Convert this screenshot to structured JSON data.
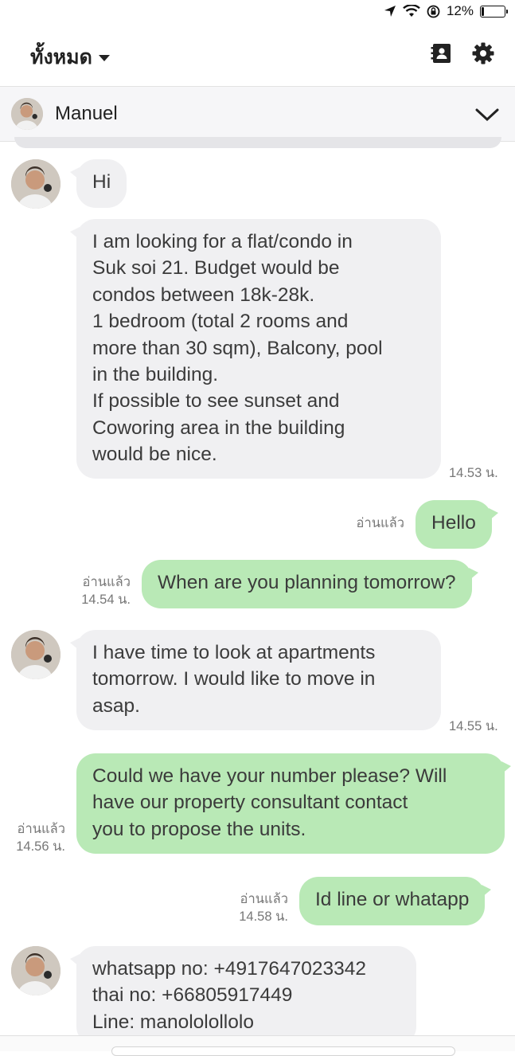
{
  "status_bar": {
    "battery": "12%",
    "battery_level": 0.12
  },
  "header": {
    "filter_label": "ทั้งหมด"
  },
  "contact": {
    "name": "Manuel"
  },
  "messages": {
    "m1": {
      "text": "Hi"
    },
    "m2": {
      "text": "I am looking for a flat/condo in\nSuk soi 21. Budget would be\ncondos between 18k-28k.\n1 bedroom (total 2 rooms and\nmore than 30 sqm), Balcony, pool\nin the building.\nIf possible to see sunset and\nCoworing area in the building\nwould be nice.",
      "time": "14.53 น."
    },
    "m3": {
      "text": "Hello",
      "read": "อ่านแล้ว"
    },
    "m4": {
      "text": "When are you planning tomorrow?",
      "read": "อ่านแล้ว",
      "time": "14.54 น."
    },
    "m5": {
      "text": "I have time to look at apartments\ntomorrow. I would like to move in\nasap.",
      "time": "14.55 น."
    },
    "m6": {
      "text": "Could we have your number please? Will\nhave our property consultant contact\nyou to propose the units.",
      "read": "อ่านแล้ว",
      "time": "14.56 น."
    },
    "m7": {
      "text": "Id line or whatapp",
      "read": "อ่านแล้ว",
      "time": "14.58 น."
    },
    "m8": {
      "text": "whatsapp no: +4917647023342\nthai no: +66805917449\nLine: manolololl​olo"
    }
  },
  "colors": {
    "incoming_bubble": "#f0f0f2",
    "outgoing_bubble": "#b9e9b6"
  }
}
